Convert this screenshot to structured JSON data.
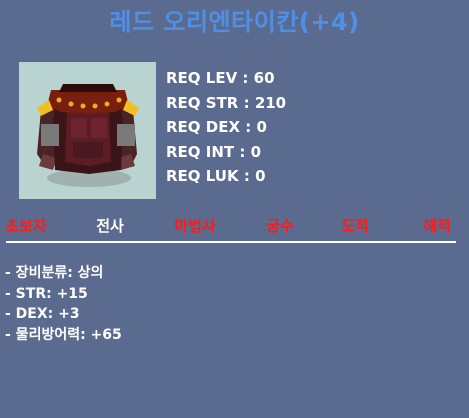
{
  "item": {
    "name": "레드 오리엔타이칸(+4)",
    "icon": "red-armor-overall-icon"
  },
  "requirements": [
    {
      "label": "REQ LEV",
      "value": "60"
    },
    {
      "label": "REQ STR",
      "value": "210"
    },
    {
      "label": "REQ DEX",
      "value": "0"
    },
    {
      "label": "REQ INT",
      "value": "0"
    },
    {
      "label": "REQ LUK",
      "value": "0"
    }
  ],
  "jobs": [
    {
      "name": "초보자",
      "color": "#ff1a1a"
    },
    {
      "name": "전사",
      "color": "#ffffff"
    },
    {
      "name": "마법사",
      "color": "#ff1a1a"
    },
    {
      "name": "궁수",
      "color": "#ff1a1a"
    },
    {
      "name": "도적",
      "color": "#ff1a1a"
    },
    {
      "name": "해적",
      "color": "#ff1a1a"
    }
  ],
  "stats": [
    "- 장비분류: 상의",
    "- STR: +15",
    "- DEX: +3",
    "- 물리방어력: +65"
  ],
  "colors": {
    "background": "#5a6b8f",
    "title": "#4f8fe8",
    "icon_background": "#b9d3d0"
  }
}
